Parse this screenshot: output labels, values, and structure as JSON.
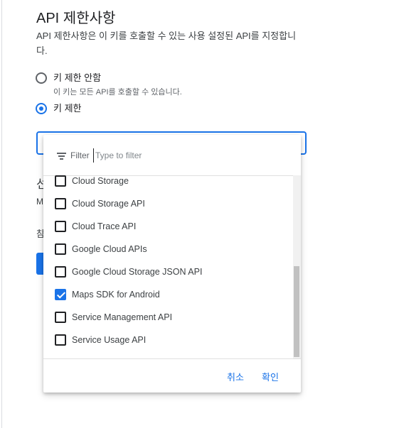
{
  "section": {
    "title": "API 제한사항",
    "description": "API 제한사항은 이 키를 호출할 수 있는 사용 설정된 API를 지정합니다."
  },
  "radios": [
    {
      "label": "키 제한 안함",
      "sublabel": "이 키는 모든 API를 호출할 수 있습니다.",
      "checked": false
    },
    {
      "label": "키 제한",
      "checked": true
    }
  ],
  "background_partial": {
    "line1": "선",
    "line2": "M",
    "line3": "참"
  },
  "dropdown": {
    "filter_label": "Filter",
    "filter_placeholder": "Type to filter",
    "items": [
      {
        "label": "Cloud Storage",
        "checked": false
      },
      {
        "label": "Cloud Storage API",
        "checked": false
      },
      {
        "label": "Cloud Trace API",
        "checked": false
      },
      {
        "label": "Google Cloud APIs",
        "checked": false
      },
      {
        "label": "Google Cloud Storage JSON API",
        "checked": false
      },
      {
        "label": "Maps SDK for Android",
        "checked": true
      },
      {
        "label": "Service Management API",
        "checked": false
      },
      {
        "label": "Service Usage API",
        "checked": false
      }
    ],
    "cancel_label": "취소",
    "confirm_label": "확인"
  },
  "colors": {
    "accent": "#1a73e8",
    "text": "#202124",
    "secondary_text": "#5f6368"
  }
}
